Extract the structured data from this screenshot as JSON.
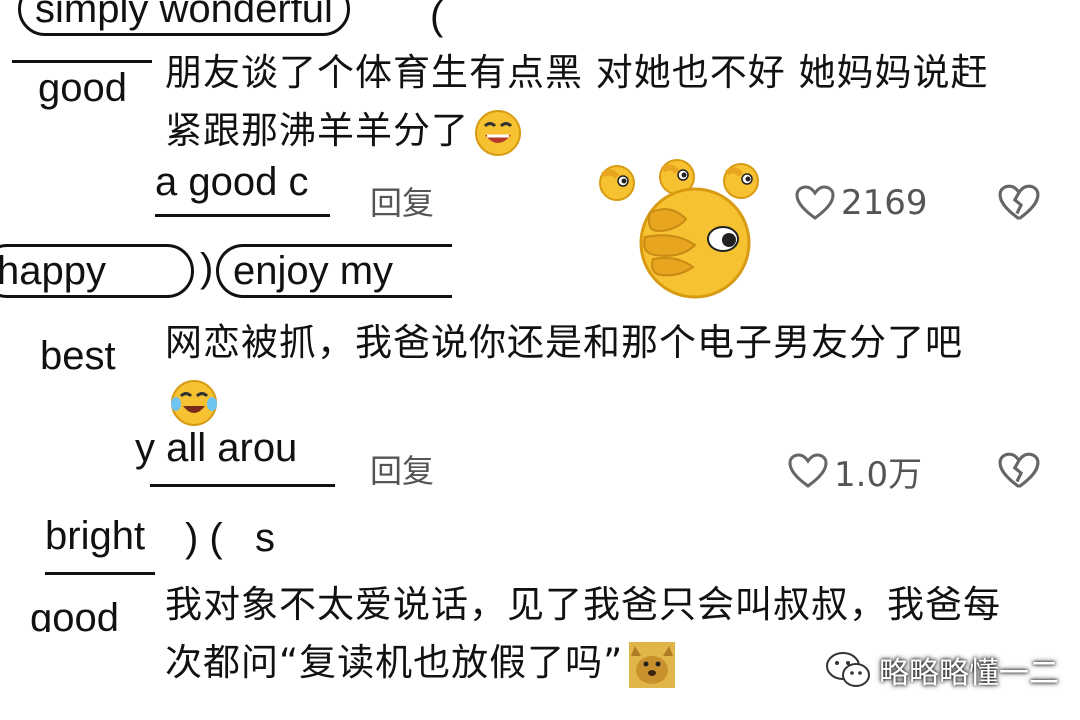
{
  "background_fragments": {
    "a": "simply wonderful",
    "b": "good",
    "c": "a good c",
    "d": "happy",
    "e": "enjoy my",
    "f": "best",
    "g": "y all arou",
    "h": "bright",
    "i": "s",
    "j": "good"
  },
  "comments": [
    {
      "text": "朋友谈了个体育生有点黑 对她也不好 她妈妈说赶紧跟那沸羊羊分了",
      "emoji": "laughing-tears-emoji",
      "reply_label": "回复",
      "likes": "2169"
    },
    {
      "text": "网恋被抓，我爸说你还是和那个电子男友分了吧",
      "emoji": "crying-laughing-emoji",
      "reply_label": "回复",
      "likes": "1.0万"
    },
    {
      "text": "我对象不太爱说话，见了我爸只会叫叔叔，我爸每次都问“复读机也放假了吗”",
      "emoji": "dog-meme-emoji"
    }
  ],
  "watermark": {
    "text": "略略略懂一二",
    "icon": "wechat-icon"
  },
  "sticker": {
    "name": "face-palm-emoji-sticker"
  },
  "colors": {
    "emoji_yellow": "#f7c231",
    "text": "#111111",
    "meta_gray": "#555555"
  }
}
